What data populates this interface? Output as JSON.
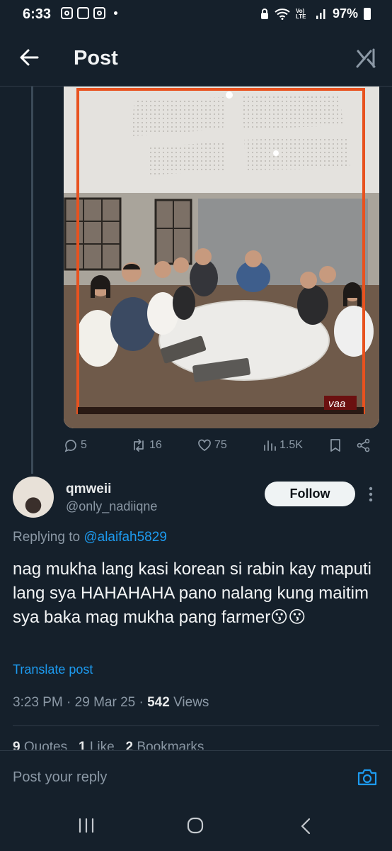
{
  "status_bar": {
    "time": "6:33",
    "network": "Vo) LTE",
    "battery": "97%"
  },
  "header": {
    "title": "Post"
  },
  "media": {
    "watermark": "vaa"
  },
  "parent_actions": {
    "replies": "5",
    "reposts": "16",
    "likes": "75",
    "views": "1.5K"
  },
  "reply_post": {
    "display_name": "qmweii",
    "handle": "@only_nadiiqne",
    "follow_label": "Follow",
    "replying_prefix": "Replying to",
    "replying_to": "@alaifah5829",
    "text": "nag mukha lang kasi korean si rabin kay maputi lang sya HAHAHAHA pano nalang kung maitim sya baka mag mukha pang farmer😗😗",
    "translate_label": "Translate post",
    "time": "3:23 PM",
    "date": "29 Mar 25",
    "views_count": "542",
    "views_label": "Views",
    "quotes_count": "9",
    "quotes_label": "Quotes",
    "likes_count": "1",
    "likes_label": "Like",
    "bookmarks_count": "2",
    "bookmarks_label": "Bookmarks"
  },
  "composer": {
    "placeholder": "Post your reply"
  },
  "colors": {
    "background": "#15202b",
    "accent": "#1d9bf0",
    "muted": "#8b98a5",
    "frame": "#e8521f"
  }
}
